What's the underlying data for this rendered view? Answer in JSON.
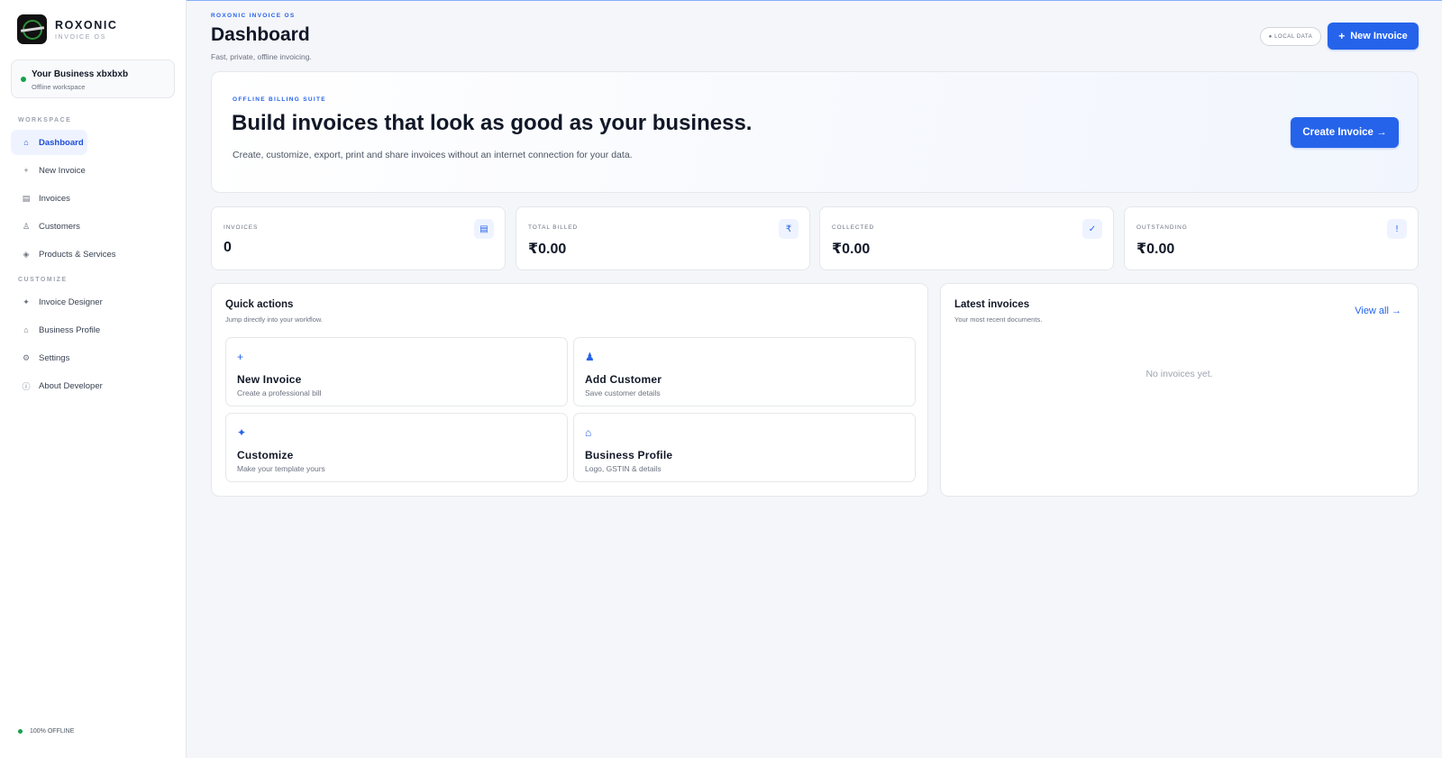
{
  "brand": {
    "name": "ROXONIC",
    "subtitle": "INVOICE OS"
  },
  "workspace": {
    "name": "Your Business xbxbxb",
    "subtitle": "Offline workspace"
  },
  "sidebar": {
    "workspace_label": "WORKSPACE",
    "customize_label": "CUSTOMIZE",
    "items": [
      {
        "label": "Dashboard",
        "icon": "home-icon",
        "glyph": "⌂",
        "active": true
      },
      {
        "label": "New Invoice",
        "icon": "plus-icon",
        "glyph": "+"
      },
      {
        "label": "Invoices",
        "icon": "list-icon",
        "glyph": "▤"
      },
      {
        "label": "Customers",
        "icon": "person-icon",
        "glyph": "♙"
      },
      {
        "label": "Products & Services",
        "icon": "diamond-icon",
        "glyph": "◈"
      },
      {
        "label": "Invoice Designer",
        "icon": "sparkle-icon",
        "glyph": "✦"
      },
      {
        "label": "Business Profile",
        "icon": "home-icon",
        "glyph": "⌂"
      },
      {
        "label": "Settings",
        "icon": "gear-icon",
        "glyph": "⚙"
      },
      {
        "label": "About Developer",
        "icon": "info-icon",
        "glyph": "ⓘ"
      }
    ],
    "offline_status": "100% OFFLINE"
  },
  "header": {
    "kicker": "ROXONIC INVOICE OS",
    "title": "Dashboard",
    "subtitle": "Fast, private, offline invoicing.",
    "badge": "● LOCAL DATA",
    "new_invoice_label": "New Invoice",
    "new_invoice_glyph": "+"
  },
  "hero": {
    "kicker": "OFFLINE BILLING SUITE",
    "title": "Build invoices that look as good as your business.",
    "subtitle": "Create, customize, export, print and share invoices without an internet connection for your data.",
    "cta": "Create Invoice →"
  },
  "stats": [
    {
      "label": "INVOICES",
      "value": "0",
      "icon": "document-icon",
      "glyph": "▤"
    },
    {
      "label": "TOTAL BILLED",
      "value": "₹0.00",
      "icon": "rupee-icon",
      "glyph": "₹"
    },
    {
      "label": "COLLECTED",
      "value": "₹0.00",
      "icon": "check-icon",
      "glyph": "✓"
    },
    {
      "label": "OUTSTANDING",
      "value": "₹0.00",
      "icon": "alert-icon",
      "glyph": "!"
    }
  ],
  "quick_actions": {
    "title": "Quick actions",
    "subtitle": "Jump directly into your workflow.",
    "items": [
      {
        "title": "New Invoice",
        "subtitle": "Create a professional bill",
        "icon": "plus-icon",
        "glyph": "+"
      },
      {
        "title": "Add Customer",
        "subtitle": "Save customer details",
        "icon": "person-icon",
        "glyph": "♟"
      },
      {
        "title": "Customize",
        "subtitle": "Make your template yours",
        "icon": "sparkle-icon",
        "glyph": "✦"
      },
      {
        "title": "Business Profile",
        "subtitle": "Logo, GSTIN & details",
        "icon": "home-icon",
        "glyph": "⌂"
      }
    ]
  },
  "latest_invoices": {
    "title": "Latest invoices",
    "subtitle": "Your most recent documents.",
    "view_all": "View all →",
    "empty": "No invoices yet."
  },
  "colors": {
    "accent": "#2563eb",
    "online": "#16a34a",
    "background": "#f5f6fa"
  }
}
